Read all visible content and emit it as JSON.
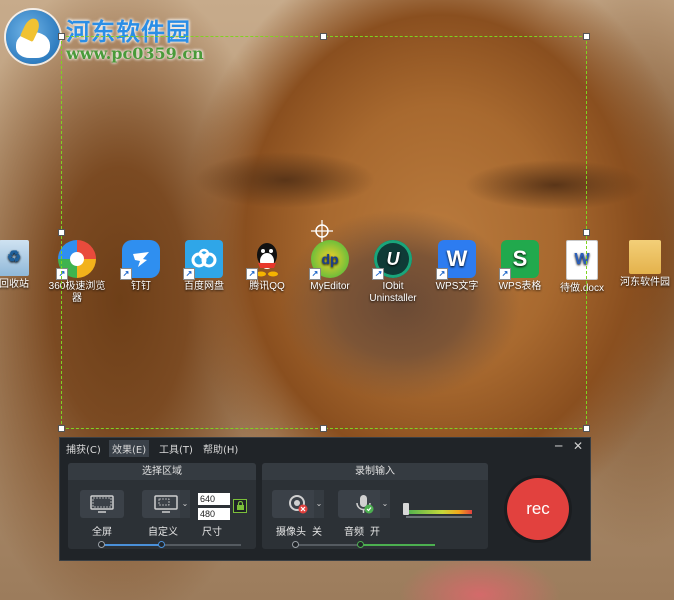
{
  "watermark": {
    "title": "河东软件园",
    "url": "www.pc0359.cn"
  },
  "desktop_icons": [
    {
      "label": "回收站",
      "icon": "recycle-bin-icon",
      "color": "#8fb8d9"
    },
    {
      "label": "360极速浏览器",
      "icon": "browser-360-icon",
      "color": "#f2b21b"
    },
    {
      "label": "钉钉",
      "icon": "dingtalk-icon",
      "color": "#2f8ff0"
    },
    {
      "label": "百度网盘",
      "icon": "baidu-netdisk-icon",
      "color": "#2fa6e8"
    },
    {
      "label": "腾讯QQ",
      "icon": "qq-penguin-icon",
      "color": "#111111"
    },
    {
      "label": "MyEditor",
      "icon": "myeditor-icon",
      "color": "#f4d02a"
    },
    {
      "label": "IObit Uninstaller",
      "icon": "iobit-uninstaller-icon",
      "color": "#1aa57a"
    },
    {
      "label": "WPS文字",
      "icon": "wps-writer-icon",
      "color": "#2d7cf0"
    },
    {
      "label": "WPS表格",
      "icon": "wps-spreadsheet-icon",
      "color": "#21a94d"
    },
    {
      "label": "待做.docx",
      "icon": "word-document-icon",
      "color": "#2b5eb8"
    },
    {
      "label": "河东软件园",
      "icon": "folder-icon",
      "color": "#e4b24c"
    }
  ],
  "recorder": {
    "menu": [
      "捕获(C)",
      "效果(E)",
      "工具(T)",
      "帮助(H)"
    ],
    "active_menu": "效果(E)",
    "minimize": "─",
    "close": "✕",
    "select_area": {
      "title": "选择区域",
      "fullscreen_label": "全屏",
      "custom_label": "自定义",
      "size_label": "尺寸",
      "width_value": "640",
      "height_value": "480"
    },
    "record_input": {
      "title": "录制输入",
      "camera_label": "摄像头",
      "camera_state": "关",
      "audio_label": "音频",
      "audio_state": "开"
    },
    "rec_label": "rec",
    "colors": {
      "rec": "#e2413e",
      "slider_blue": "#4a90d9",
      "slider_green": "#4caf50"
    }
  }
}
